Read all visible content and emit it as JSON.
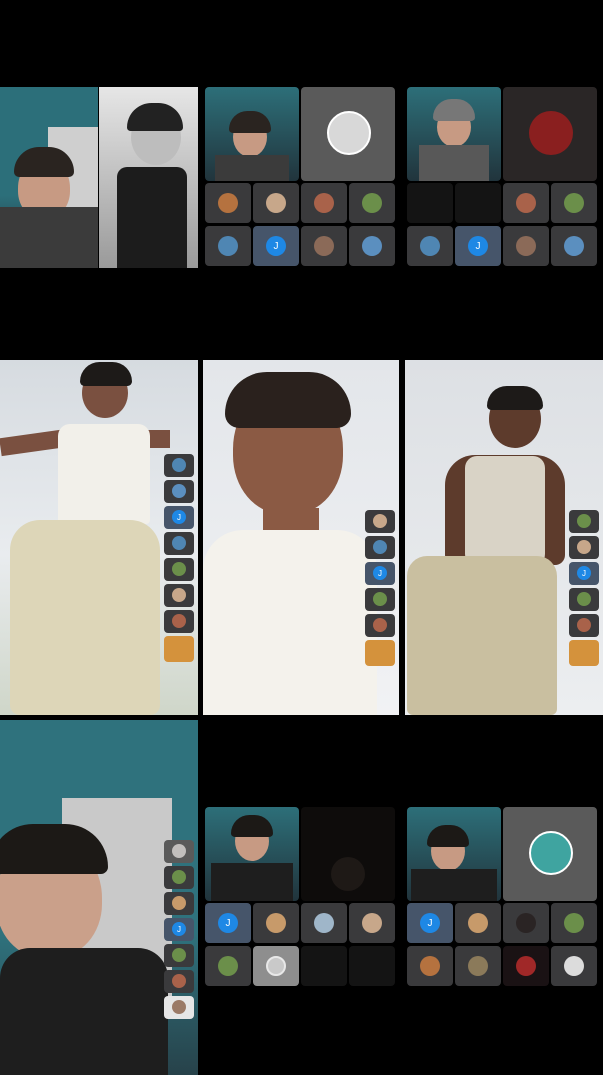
{
  "grid": {
    "rows": 3,
    "cols": 3
  },
  "initial_letter": "J",
  "colors": {
    "background": "#000000",
    "tile": "#3a3a3c",
    "avatar_accent": "#1e88e5",
    "wall_teal": "#2e6f7a",
    "sky": "#d9dde2",
    "orange_tile": "#d4923c"
  },
  "cells": [
    {
      "id": "r1c1",
      "type": "split-camera"
    },
    {
      "id": "r1c2",
      "type": "group-call-grid"
    },
    {
      "id": "r1c3",
      "type": "group-call-grid"
    },
    {
      "id": "r2c1",
      "type": "fullscreen-video"
    },
    {
      "id": "r2c2",
      "type": "fullscreen-video"
    },
    {
      "id": "r2c3",
      "type": "fullscreen-video"
    },
    {
      "id": "r3c1",
      "type": "fullscreen-video"
    },
    {
      "id": "r3c2",
      "type": "group-call-grid"
    },
    {
      "id": "r3c3",
      "type": "group-call-grid"
    }
  ]
}
